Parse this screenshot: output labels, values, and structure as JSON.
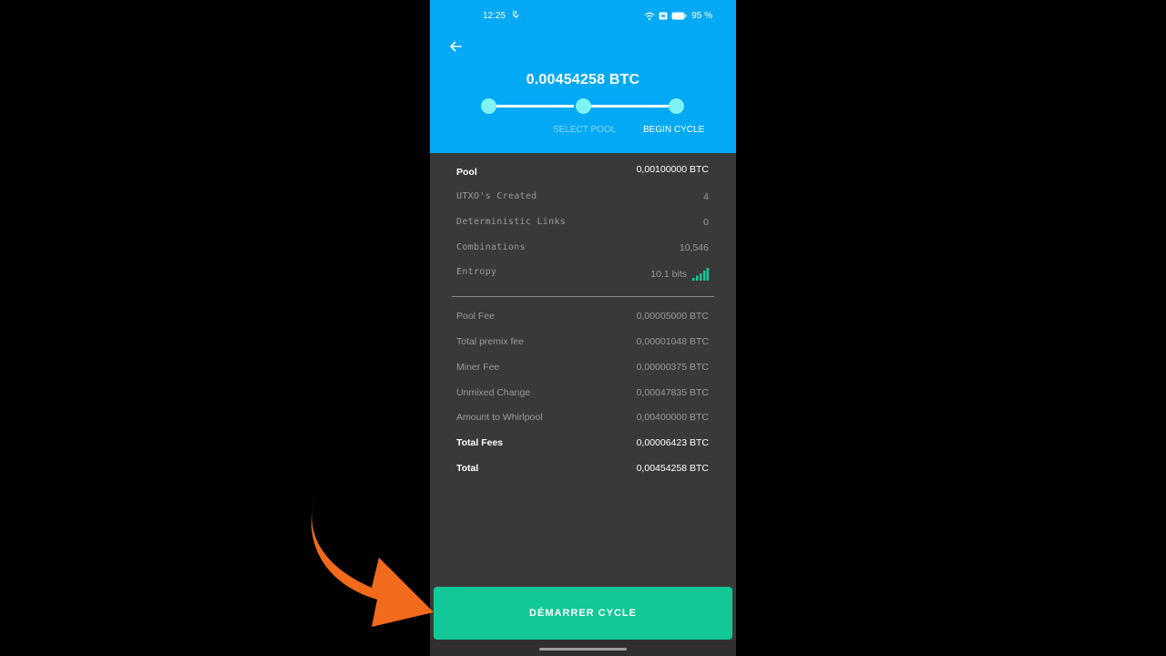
{
  "status_bar": {
    "time": "12:25",
    "extra_icon": "notification-icon",
    "icons": [
      "wifi-icon",
      "sim-icon",
      "battery-icon"
    ],
    "battery": "95 %"
  },
  "header": {
    "back_icon": "arrow-left-icon",
    "amount": "0.00454258 BTC",
    "steps": [
      {
        "label": ""
      },
      {
        "label": "SELECT POOL"
      },
      {
        "label": "BEGIN CYCLE"
      }
    ],
    "background_color": "#03a9f4",
    "step_dot_color": "#7ff3f4"
  },
  "summary": {
    "pool": {
      "label": "Pool",
      "value": "0,00100000 BTC"
    },
    "utxos_created": {
      "label": "UTXO's Created",
      "value": "4"
    },
    "deterministic_links": {
      "label": "Deterministic Links",
      "value": "0"
    },
    "combinations": {
      "label": "Combinations",
      "value": "10,546"
    },
    "entropy": {
      "label": "Entropy",
      "value": "10.1 bits",
      "icon": "signal-bars-icon"
    }
  },
  "fees": {
    "pool_fee": {
      "label": "Pool Fee",
      "value": "0,00005000 BTC"
    },
    "total_premix_fee": {
      "label": "Total premix fee",
      "value": "0,00001048 BTC"
    },
    "miner_fee": {
      "label": "Miner Fee",
      "value": "0,00000375 BTC"
    },
    "unmixed_change": {
      "label": "Unmixed Change",
      "value": "0,00047835 BTC"
    },
    "amount_to_whirlpool": {
      "label": "Amount to Whirlpool",
      "value": "0,00400000 BTC"
    },
    "total_fees": {
      "label": "Total Fees",
      "value": "0,00006423 BTC"
    },
    "total": {
      "label": "Total",
      "value": "0,00454258 BTC"
    }
  },
  "cta": {
    "label": "DÉMARRER CYCLE",
    "color": "#12c896"
  },
  "overlay": {
    "arrow_color": "#f26a1b"
  }
}
